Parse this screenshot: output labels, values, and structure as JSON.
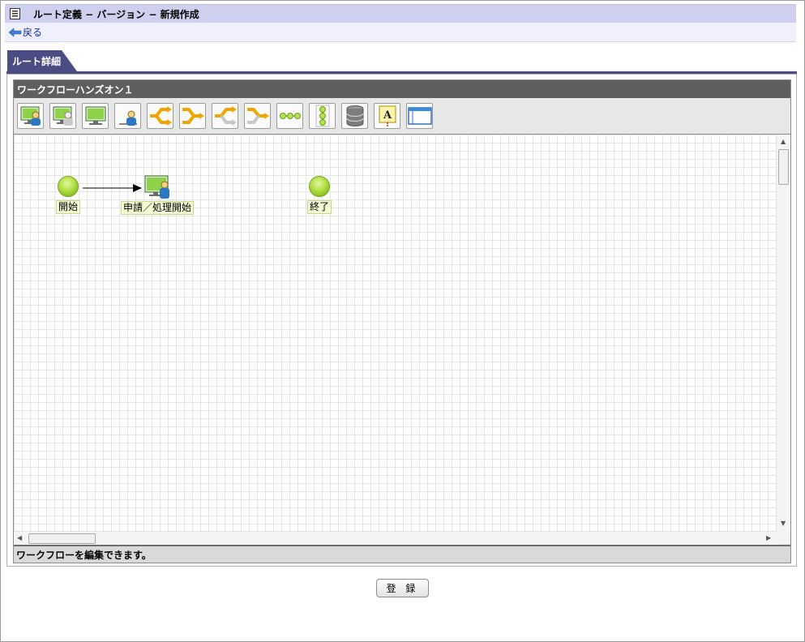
{
  "header": {
    "title": "ルート定義 − バージョン − 新規作成"
  },
  "nav": {
    "back_label": "戻る"
  },
  "tabs": [
    {
      "label": "ルート詳細"
    }
  ],
  "editor": {
    "name": "ワークフローハンズオン１",
    "toolbar_tools": [
      "user-task-icon",
      "user-task-gray-icon",
      "system-task-icon",
      "person-icon",
      "branch-split-icon",
      "branch-merge-icon",
      "split-gray-icon",
      "merge-gray-icon",
      "horizontal-nodes-icon",
      "vertical-nodes-icon",
      "database-icon",
      "text-note-icon",
      "window-icon"
    ],
    "nodes": [
      {
        "label": "開始",
        "type": "start"
      },
      {
        "label": "申請／処理開始",
        "type": "user-task"
      },
      {
        "label": "終了",
        "type": "end"
      }
    ],
    "status_message": "ワークフローを編集できます。"
  },
  "footer": {
    "register_label": "登 録"
  },
  "colors": {
    "tab": "#4b4c83",
    "title_bg": "#cfd0ee",
    "node_green": "#9bd12c",
    "arrow_orange": "#f2a400"
  }
}
